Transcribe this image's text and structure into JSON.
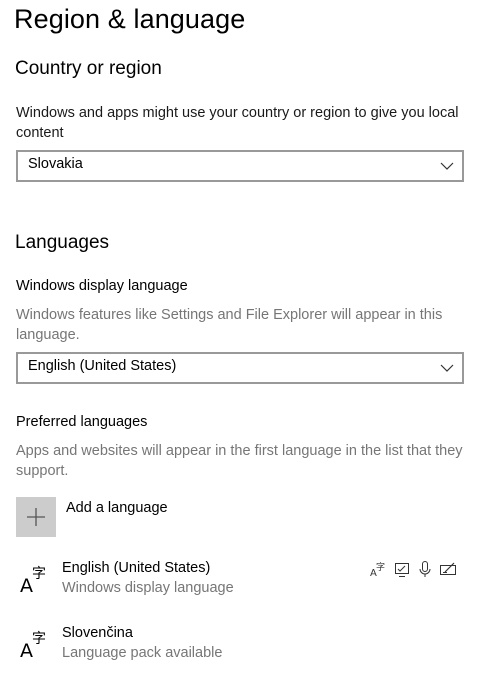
{
  "page": {
    "title": "Region & language"
  },
  "country_region": {
    "heading": "Country or region",
    "description": "Windows and apps might use your country or region to give you local content",
    "selected": "Slovakia"
  },
  "languages": {
    "heading": "Languages",
    "display_language_label": "Windows display language",
    "display_language_description": "Windows features like Settings and File Explorer will appear in this language.",
    "display_language_selected": "English (United States)",
    "preferred_label": "Preferred languages",
    "preferred_description": "Apps and websites will appear in the first language in the list that they support.",
    "add_language_label": "Add a language",
    "list": [
      {
        "name": "English (United States)",
        "status": "Windows display language",
        "feature_icons": [
          "language-pack-icon",
          "text-to-speech-icon",
          "speech-recognition-icon",
          "handwriting-icon"
        ]
      },
      {
        "name": "Slovenčina",
        "status": "Language pack available",
        "feature_icons": []
      }
    ]
  },
  "colors": {
    "text": "#000000",
    "secondary_text": "#767676",
    "combo_border": "#999999",
    "add_tile": "#cccccc"
  }
}
